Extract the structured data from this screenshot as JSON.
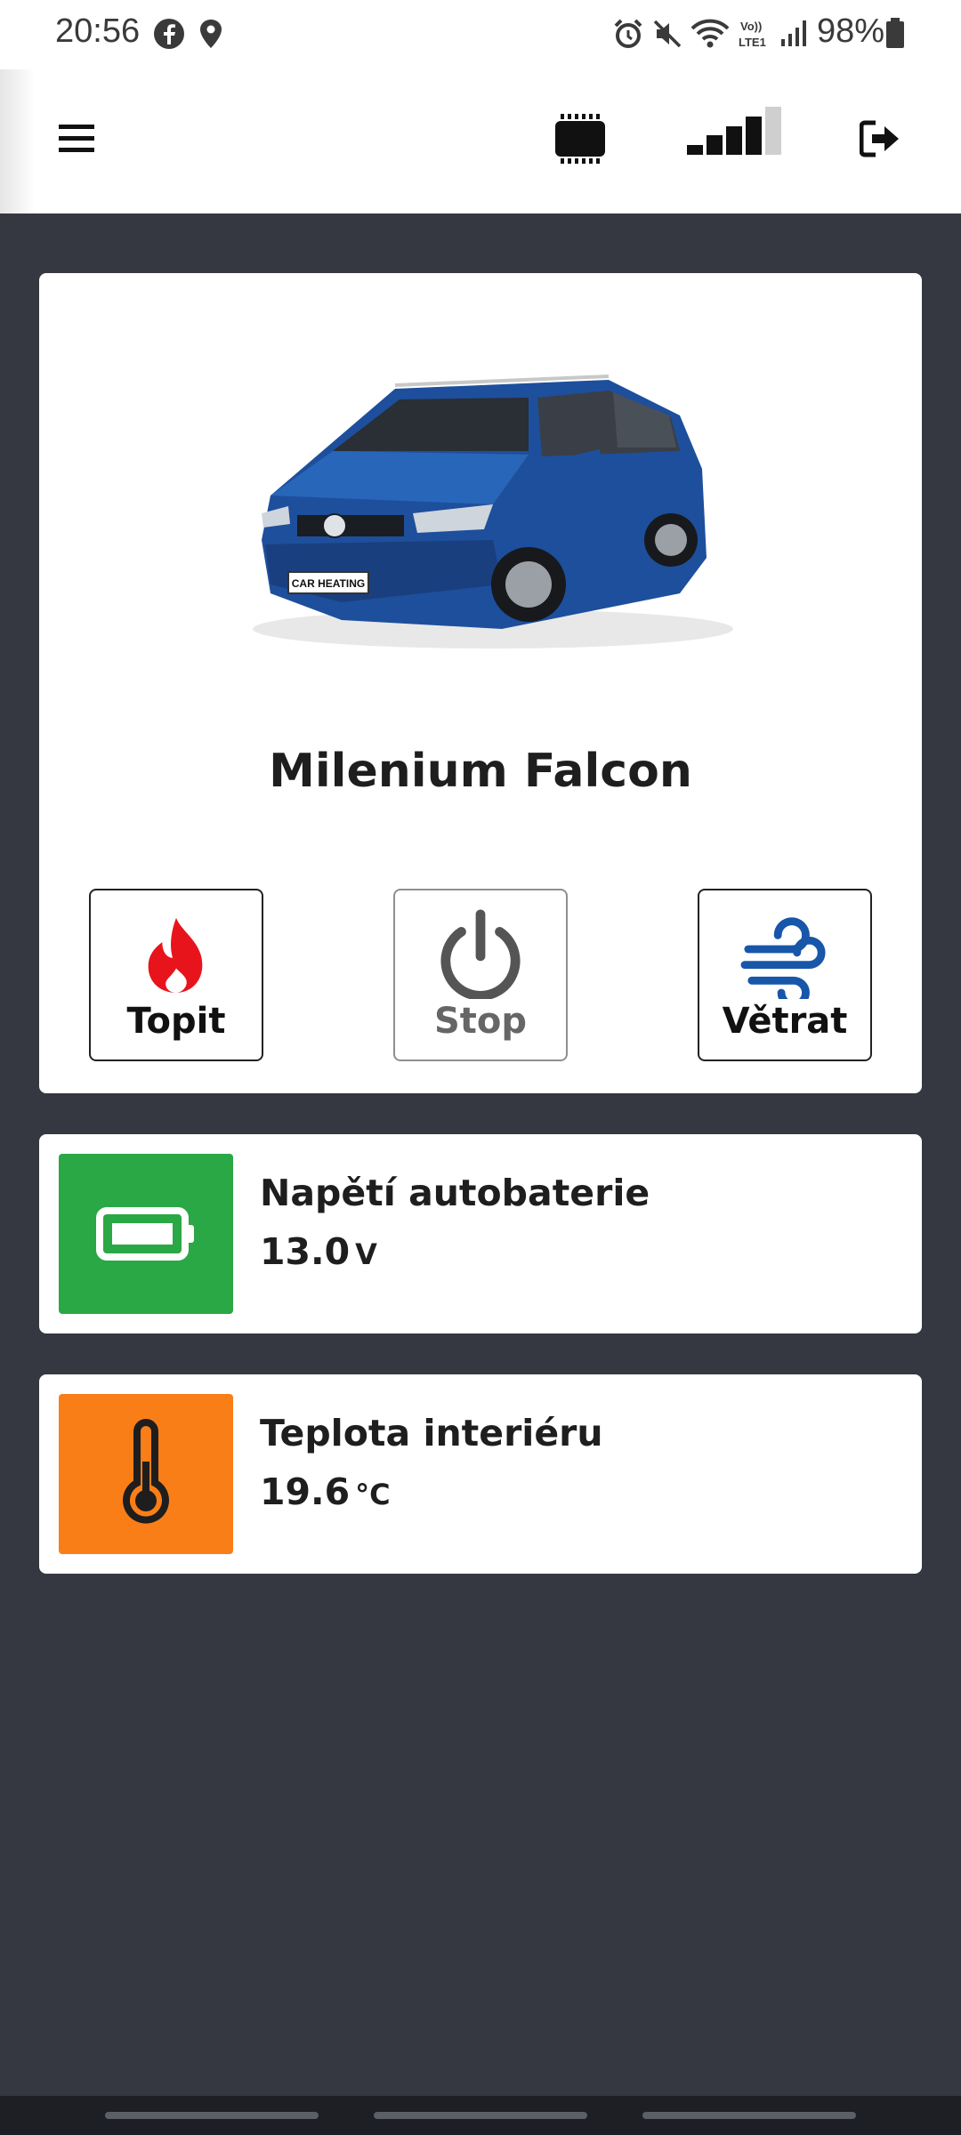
{
  "status_bar": {
    "time": "20:56",
    "battery_percent": "98%",
    "left_icons": [
      "facebook-icon",
      "location-icon"
    ],
    "right_icons": [
      "alarm-icon",
      "mute-icon",
      "wifi-icon",
      "volte-icon",
      "signal-icon",
      "battery-icon"
    ]
  },
  "header": {
    "menu_icon": "hamburger-icon",
    "device_icon": "controller-chip-icon",
    "signal_level": 4,
    "signal_max": 5,
    "logout_icon": "logout-icon"
  },
  "vehicle": {
    "name": "Milenium Falcon",
    "plate_text": "CAR HEATING"
  },
  "actions": [
    {
      "label": "Topit",
      "icon": "flame-icon",
      "color": "#e8141c",
      "enabled": true
    },
    {
      "label": "Stop",
      "icon": "power-icon",
      "color": "#555555",
      "enabled": false
    },
    {
      "label": "Větrat",
      "icon": "wind-icon",
      "color": "#1756a9",
      "enabled": true
    }
  ],
  "battery": {
    "title": "Napětí autobaterie",
    "value": "13.0",
    "unit": "V",
    "tile_color": "#2aa845",
    "icon": "battery-icon"
  },
  "temperature": {
    "title": "Teplota interiéru",
    "value": "19.6",
    "unit": "°C",
    "tile_color": "#fa7e18",
    "icon": "thermometer-icon"
  },
  "colors": {
    "background": "#353840",
    "card": "#ffffff",
    "text": "#1e1e1e"
  }
}
